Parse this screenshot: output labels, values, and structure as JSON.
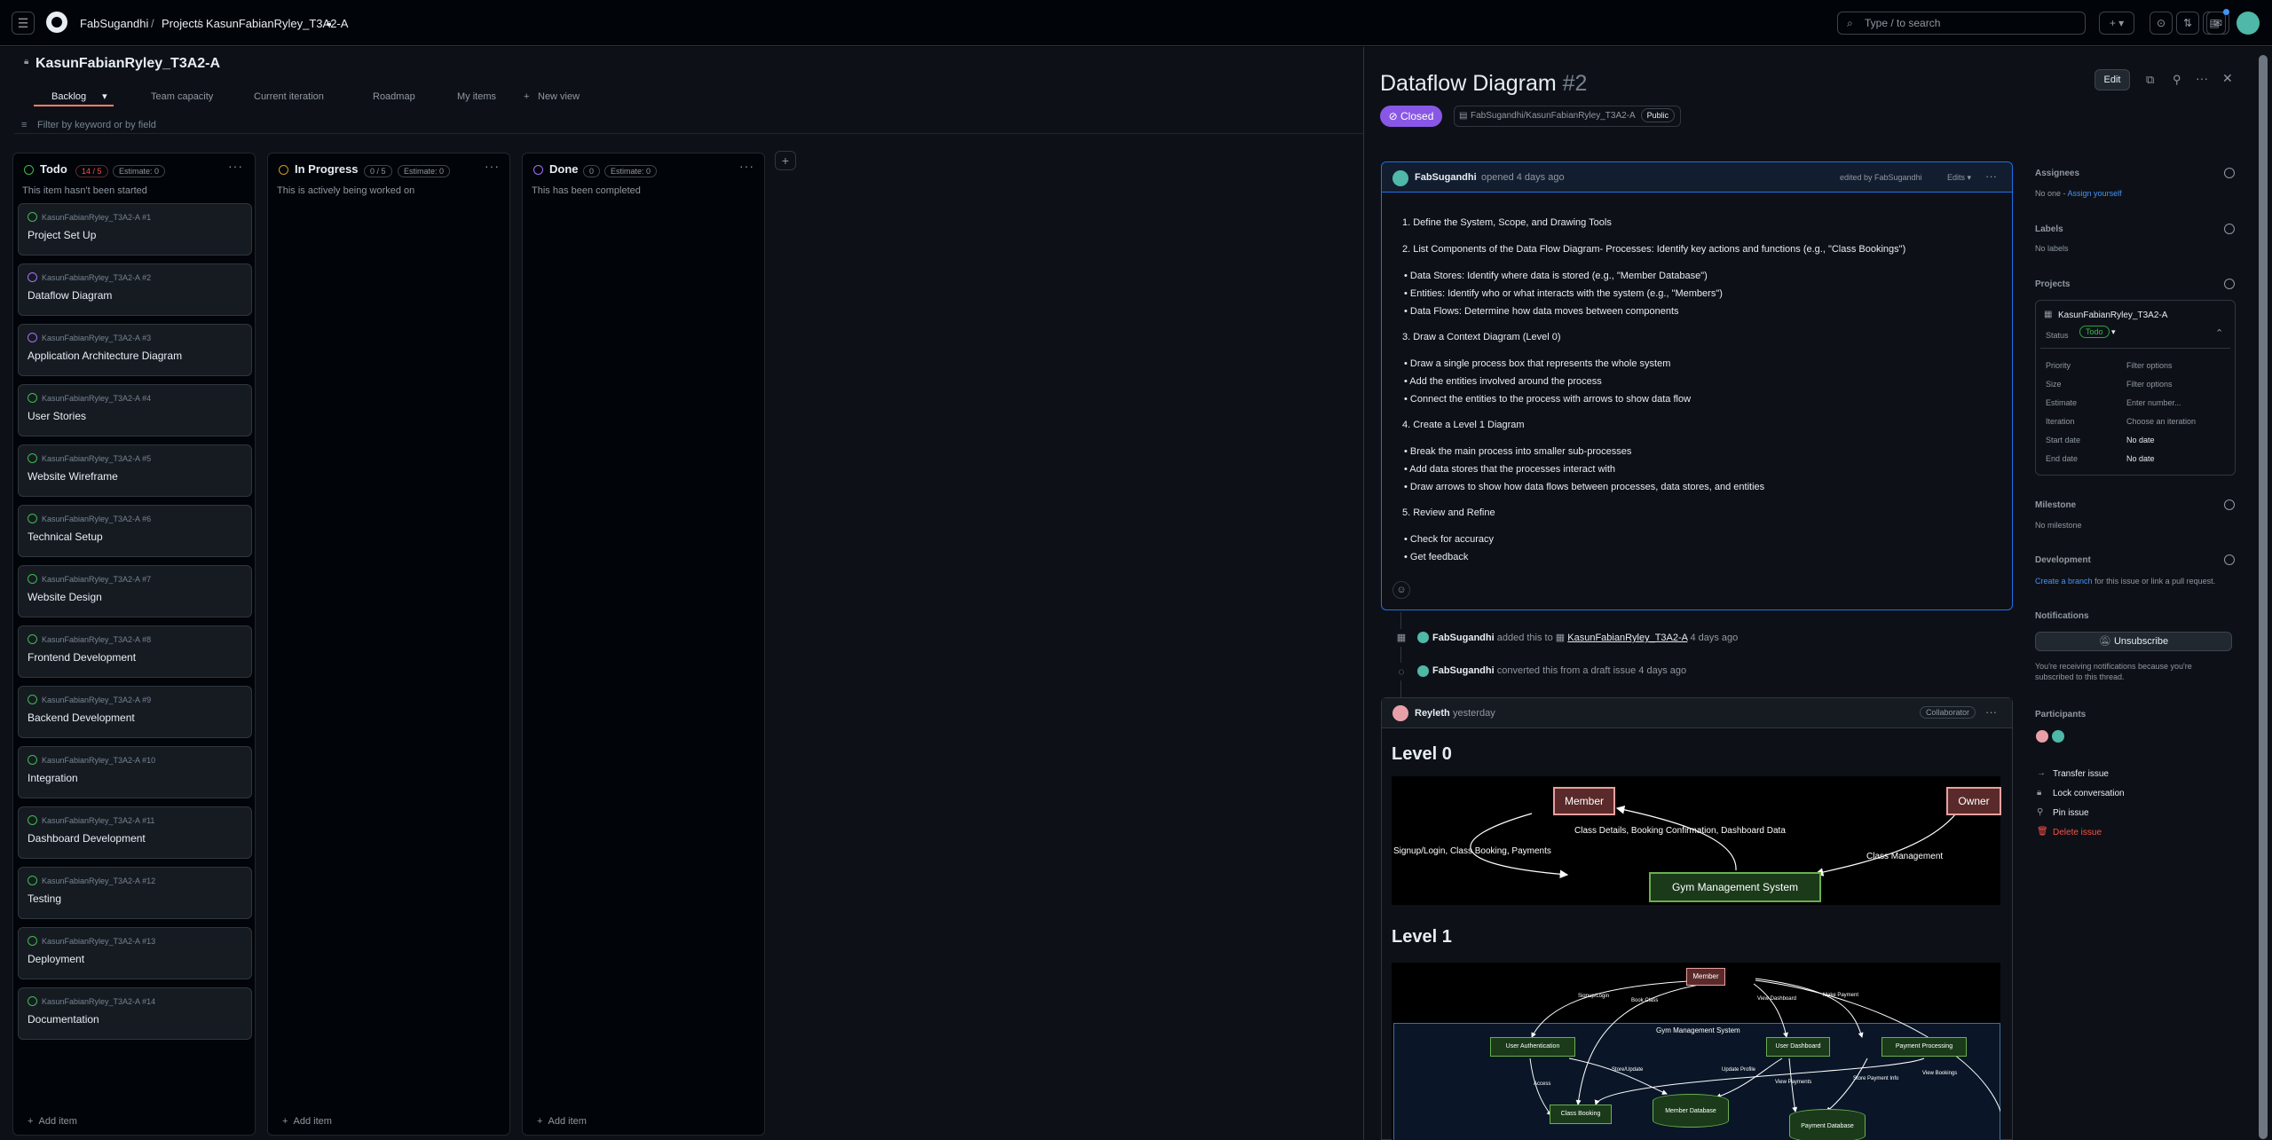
{
  "nav": {
    "owner": "FabSugandhi",
    "projects": "Projects",
    "project": "KasunFabianRyley_T3A2-A",
    "search_placeholder": "Type / to search"
  },
  "project": {
    "title": "KasunFabianRyley_T3A2-A",
    "views": [
      "Backlog",
      "Team capacity",
      "Current iteration",
      "Roadmap",
      "My items",
      "New view"
    ],
    "filter_placeholder": "Filter by keyword or by field"
  },
  "columns": [
    {
      "name": "Todo",
      "count": "14 / 5",
      "estimate": "Estimate: 0",
      "desc": "This item hasn't been started",
      "status_color": "#3fb950"
    },
    {
      "name": "In Progress",
      "count": "0 / 5",
      "estimate": "Estimate: 0",
      "desc": "This is actively being worked on",
      "status_color": "#d29922"
    },
    {
      "name": "Done",
      "count": "0",
      "estimate": "Estimate: 0",
      "desc": "This has been completed",
      "status_color": "#a371f7"
    }
  ],
  "cards": [
    {
      "repo": "KasunFabianRyley_T3A2-A #1",
      "title": "Project Set Up",
      "closed": false
    },
    {
      "repo": "KasunFabianRyley_T3A2-A #2",
      "title": "Dataflow Diagram",
      "closed": true
    },
    {
      "repo": "KasunFabianRyley_T3A2-A #3",
      "title": "Application Architecture Diagram",
      "closed": true
    },
    {
      "repo": "KasunFabianRyley_T3A2-A #4",
      "title": "User Stories",
      "closed": false
    },
    {
      "repo": "KasunFabianRyley_T3A2-A #5",
      "title": "Website Wireframe",
      "closed": false
    },
    {
      "repo": "KasunFabianRyley_T3A2-A #6",
      "title": "Technical Setup",
      "closed": false
    },
    {
      "repo": "KasunFabianRyley_T3A2-A #7",
      "title": "Website Design",
      "closed": false
    },
    {
      "repo": "KasunFabianRyley_T3A2-A #8",
      "title": "Frontend Development",
      "closed": false
    },
    {
      "repo": "KasunFabianRyley_T3A2-A #9",
      "title": "Backend Development",
      "closed": false
    },
    {
      "repo": "KasunFabianRyley_T3A2-A #10",
      "title": "Integration",
      "closed": false
    },
    {
      "repo": "KasunFabianRyley_T3A2-A #11",
      "title": "Dashboard Development",
      "closed": false
    },
    {
      "repo": "KasunFabianRyley_T3A2-A #12",
      "title": "Testing",
      "closed": false
    },
    {
      "repo": "KasunFabianRyley_T3A2-A #13",
      "title": "Deployment",
      "closed": false
    },
    {
      "repo": "KasunFabianRyley_T3A2-A #14",
      "title": "Documentation",
      "closed": false
    }
  ],
  "add_item": "Add item",
  "issue": {
    "title": "Dataflow Diagram",
    "number": "#2",
    "state": "Closed",
    "repo": "FabSugandhi/KasunFabianRyley_T3A2-A",
    "visibility": "Public",
    "edit": "Edit",
    "author": "FabSugandhi",
    "opened": "opened 4 days ago",
    "edited": "edited by FabSugandhi",
    "edits": "Edits",
    "body": [
      "1. Define the System, Scope, and Drawing Tools",
      "2. List Components of the Data Flow Diagram- Processes: Identify key actions and functions (e.g., \"Class Bookings\")",
      "• Data Stores: Identify where data is stored (e.g., \"Member Database\")",
      "• Entities: Identify who or what interacts with the system (e.g., \"Members\")",
      "• Data Flows: Determine how data moves between components",
      "3. Draw a Context Diagram (Level 0)",
      "• Draw a single process box that represents the whole system",
      "• Add the entities involved around the process",
      "• Connect the entities to the process with arrows to show data flow",
      "4. Create a Level 1 Diagram",
      "• Break the main process into smaller sub-processes",
      "• Add data stores that the processes interact with",
      "• Draw arrows to show how data flows between processes, data stores, and entities",
      "5. Review and Refine",
      "• Check for accuracy",
      "• Get feedback"
    ],
    "timeline": [
      {
        "user": "FabSugandhi",
        "pre": "added this to",
        "target": "KasunFabianRyley_T3A2-A",
        "post": "4 days ago"
      },
      {
        "user": "FabSugandhi",
        "pre": "converted this from a draft issue 4 days ago",
        "target": "",
        "post": ""
      }
    ],
    "comment": {
      "author": "Reyleth",
      "time": "yesterday",
      "role": "Collaborator",
      "level0": "Level 0",
      "level1": "Level 1"
    }
  },
  "diagram0": {
    "member": "Member",
    "owner": "Owner",
    "system": "Gym Management System",
    "f1": "Class Details, Booking Confirmation, Dashboard Data",
    "f2": "Signup/Login, Class Booking, Payments",
    "f3": "Class Management"
  },
  "diagram1": {
    "member": "Member",
    "system": "Gym Management System",
    "auth": "User Authentication",
    "dash": "User Dashboard",
    "pay": "Payment Processing",
    "booking": "Class Booking",
    "mdb": "Member Database",
    "pdb": "Payment Database",
    "f_signup": "Signup/Login",
    "f_book": "Book Class",
    "f_view": "View Dashboard",
    "f_pay": "Make Payment",
    "f_access": "Access",
    "f_store": "Store/Update",
    "f_update": "Update Profile",
    "f_viewpay": "View Payments",
    "f_storepay": "Store Payment Info",
    "f_viewbook": "View Bookings"
  },
  "sidebar": {
    "assignees": "Assignees",
    "assignees_val": "No one -",
    "assign_yourself": "Assign yourself",
    "labels": "Labels",
    "labels_val": "No labels",
    "projects": "Projects",
    "proj_name": "KasunFabianRyley_T3A2-A",
    "status_label": "Status",
    "status_val": "Todo",
    "fields": [
      {
        "label": "Priority",
        "value": "Filter options",
        "bold": false
      },
      {
        "label": "Size",
        "value": "Filter options",
        "bold": false
      },
      {
        "label": "Estimate",
        "value": "Enter number...",
        "bold": false
      },
      {
        "label": "Iteration",
        "value": "Choose an iteration",
        "bold": false
      },
      {
        "label": "Start date",
        "value": "No date",
        "bold": true
      },
      {
        "label": "End date",
        "value": "No date",
        "bold": true
      }
    ],
    "milestone": "Milestone",
    "milestone_val": "No milestone",
    "development": "Development",
    "dev_link": "Create a branch",
    "dev_rest": "for this issue or link a pull request.",
    "notifications": "Notifications",
    "unsubscribe": "Unsubscribe",
    "notif_text": "You're receiving notifications because you're subscribed to this thread.",
    "participants": "Participants",
    "actions": [
      "Transfer issue",
      "Lock conversation",
      "Pin issue",
      "Delete issue"
    ]
  }
}
